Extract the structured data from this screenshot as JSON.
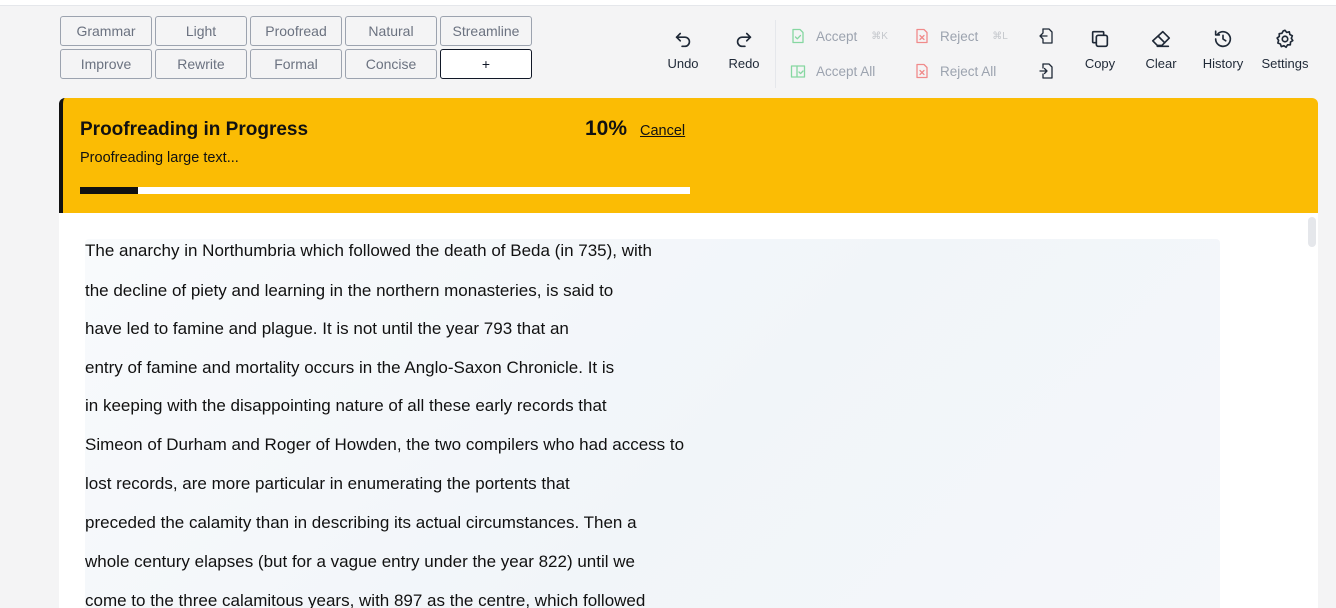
{
  "presets": [
    "Grammar",
    "Light",
    "Proofread",
    "Natural",
    "Streamline",
    "Improve",
    "Rewrite",
    "Formal",
    "Concise",
    "+"
  ],
  "toolbar": {
    "undo": "Undo",
    "redo": "Redo",
    "accept": "Accept",
    "accept_shortcut": "⌘K",
    "accept_all": "Accept All",
    "reject": "Reject",
    "reject_shortcut": "⌘L",
    "reject_all": "Reject All",
    "copy": "Copy",
    "clear": "Clear",
    "history": "History",
    "settings": "Settings"
  },
  "banner": {
    "title": "Proofreading in Progress",
    "subtitle": "Proofreading large text...",
    "percent": "10%",
    "progress": 0.095,
    "cancel": "Cancel"
  },
  "colors": {
    "banner_bg": "#fbbc04",
    "accept": "#22c55e",
    "reject": "#ef4444"
  },
  "editor": {
    "lines": [
      "The anarchy in Northumbria which followed the death of Beda (in 735), with",
      "the decline of piety and learning in the northern monasteries, is said to",
      "have led to famine and plague. It is not until the year 793 that an",
      "entry of famine and mortality occurs in the Anglo-Saxon Chronicle. It is",
      "in keeping with the disappointing nature of all these early records that",
      "Simeon of Durham and Roger of Howden, the two compilers who had access to",
      "lost records, are more particular in enumerating the portents that",
      "preceded the calamity than in describing its actual circumstances. Then a",
      "whole century elapses (but for a vague entry under the year 822) until we",
      "come to the three calamitous years, with 897 as the centre, which followed"
    ]
  }
}
